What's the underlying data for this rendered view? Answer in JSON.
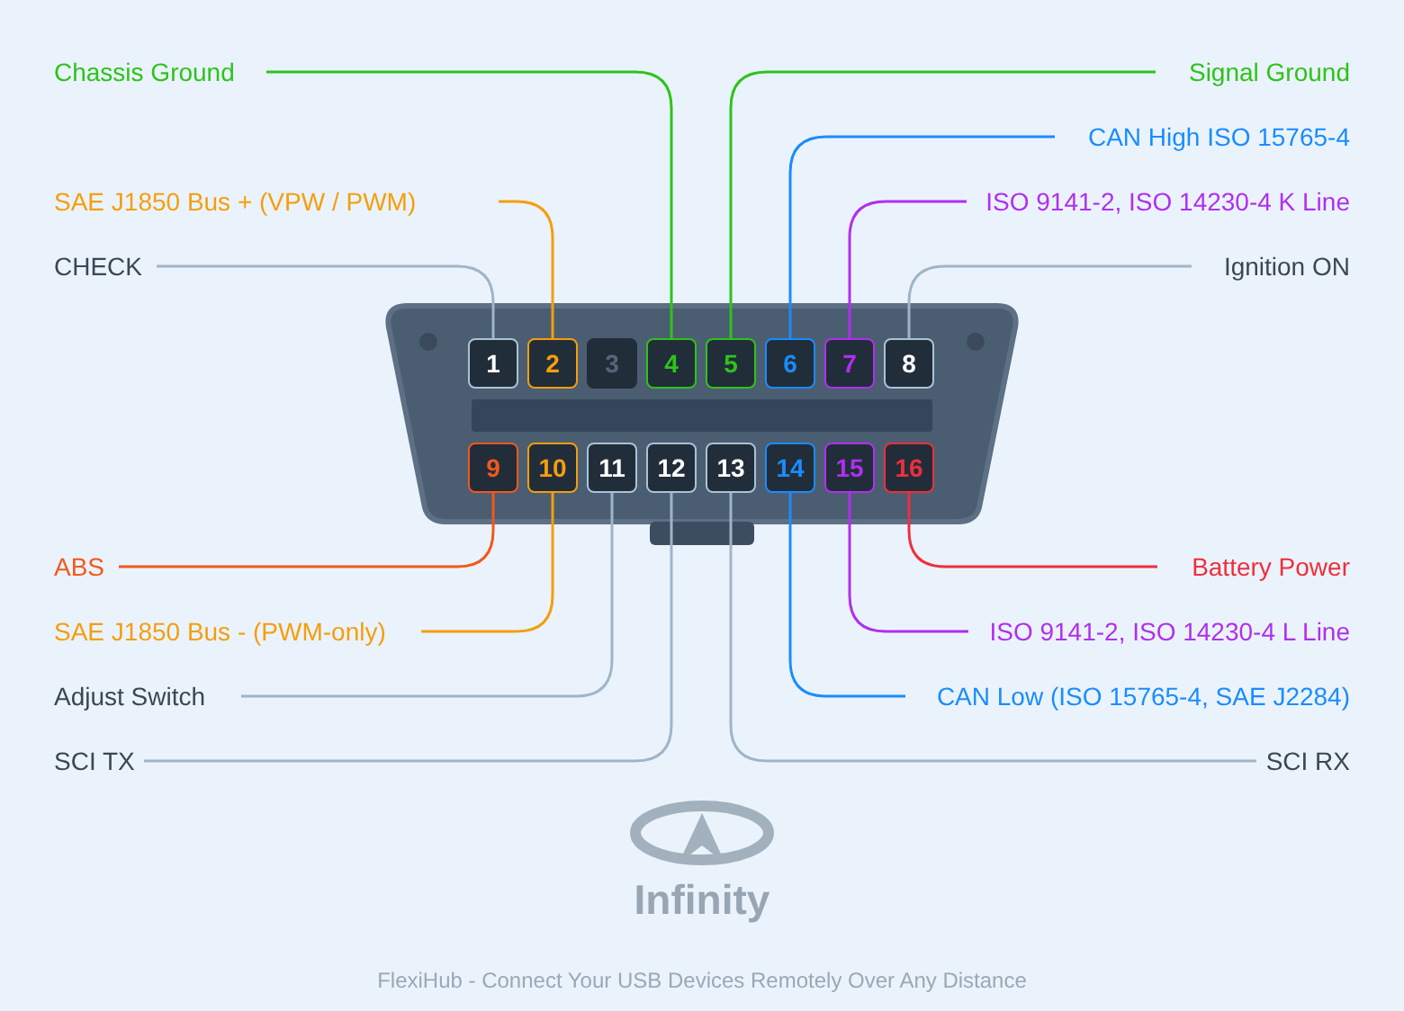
{
  "labels": [
    {
      "text": "Chassis Ground",
      "kind": "colored",
      "color": "#2ec31b"
    },
    {
      "text": "Signal Ground",
      "kind": "colored",
      "color": "#2ec31b"
    },
    {
      "text": "CAN High ISO 15765-4",
      "kind": "colored",
      "color": "#1a8cff"
    },
    {
      "text": "SAE J1850 Bus + (VPW / PWM)",
      "kind": "colored",
      "color": "#f59e0b"
    },
    {
      "text": "ISO 9141-2, ISO 14230-4 K Line",
      "kind": "colored",
      "color": "#b02ff0"
    },
    {
      "text": "CHECK",
      "kind": "plain"
    },
    {
      "text": "Ignition ON",
      "kind": "plain"
    },
    {
      "text": "ABS",
      "kind": "colored",
      "color": "#f2581c"
    },
    {
      "text": "Battery Power",
      "kind": "colored",
      "color": "#ef2f3c"
    },
    {
      "text": "SAE J1850 Bus - (PWM-only)",
      "kind": "colored",
      "color": "#f59e0b"
    },
    {
      "text": "ISO 9141-2, ISO 14230-4 L Line",
      "kind": "colored",
      "color": "#b02ff0"
    },
    {
      "text": "Adjust Switch",
      "kind": "plain"
    },
    {
      "text": "CAN Low (ISO 15765-4, SAE J2284)",
      "kind": "colored",
      "color": "#1a8cff"
    },
    {
      "text": "SCI TX",
      "kind": "plain"
    },
    {
      "text": "SCI RX",
      "kind": "plain"
    }
  ],
  "pins": [
    {
      "number": "1",
      "kind": "plain"
    },
    {
      "number": "2",
      "kind": "colored",
      "color": "#f59e0b"
    },
    {
      "number": "3",
      "kind": "empty"
    },
    {
      "number": "4",
      "kind": "colored",
      "color": "#2ec31b"
    },
    {
      "number": "5",
      "kind": "colored",
      "color": "#2ec31b"
    },
    {
      "number": "6",
      "kind": "colored",
      "color": "#1a8cff"
    },
    {
      "number": "7",
      "kind": "colored",
      "color": "#b02ff0"
    },
    {
      "number": "8",
      "kind": "plain"
    },
    {
      "number": "9",
      "kind": "colored",
      "color": "#f2581c"
    },
    {
      "number": "10",
      "kind": "colored",
      "color": "#f59e0b"
    },
    {
      "number": "11",
      "kind": "plain"
    },
    {
      "number": "12",
      "kind": "plain"
    },
    {
      "number": "13",
      "kind": "plain"
    },
    {
      "number": "14",
      "kind": "colored",
      "color": "#1a8cff"
    },
    {
      "number": "15",
      "kind": "colored",
      "color": "#b02ff0"
    },
    {
      "number": "16",
      "kind": "colored",
      "color": "#ef2f3c"
    }
  ],
  "brand": "Infinity",
  "footer": "FlexiHub - Connect Your USB Devices Remotely Over Any Distance"
}
